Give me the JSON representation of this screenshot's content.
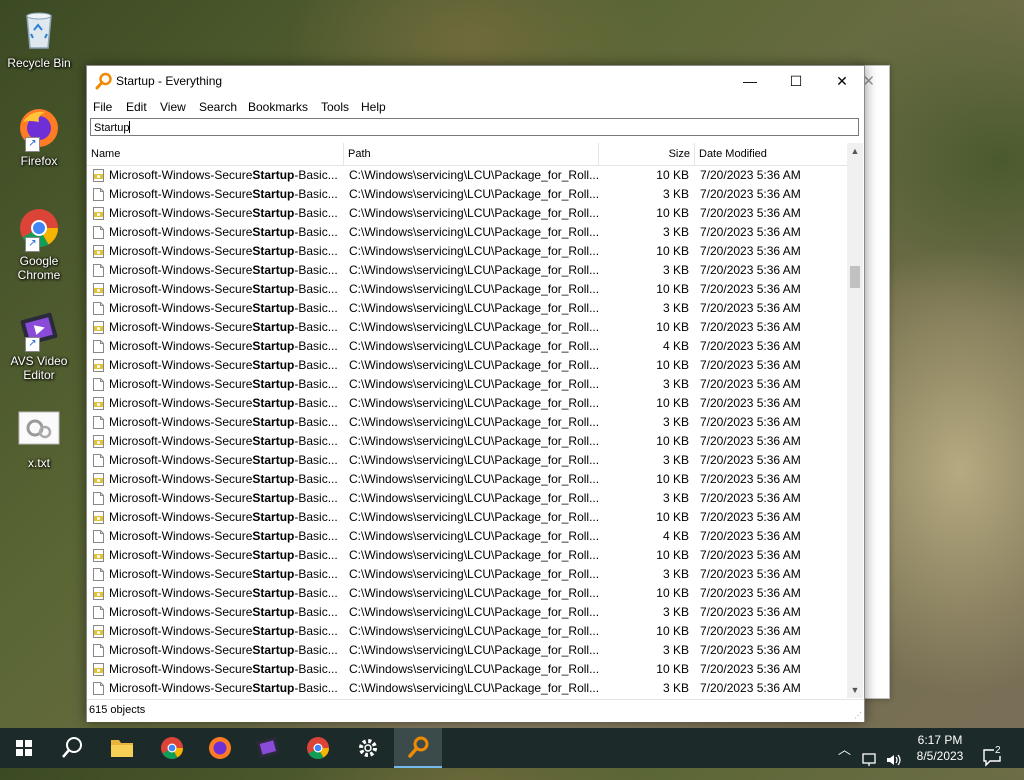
{
  "desktop": {
    "icons": [
      {
        "label": "Recycle Bin"
      },
      {
        "label": "Firefox"
      },
      {
        "label": "Google Chrome"
      },
      {
        "label": "AVS Video Editor"
      },
      {
        "label": "x.txt"
      }
    ]
  },
  "window": {
    "title": "Startup - Everything",
    "controls": {
      "minimize": "—",
      "maximize": "☐",
      "close": "✕"
    },
    "menu": [
      "File",
      "Edit",
      "View",
      "Search",
      "Bookmarks",
      "Tools",
      "Help"
    ],
    "search": {
      "value": "Startup"
    },
    "columns": {
      "name": "Name",
      "path": "Path",
      "size": "Size",
      "date": "Date Modified"
    },
    "rows": [
      {
        "name_prefix": "Microsoft-Windows-Secure",
        "name_match": "Startup",
        "name_suffix": "-Basic...",
        "path": "C:\\Windows\\servicing\\LCU\\Package_for_Roll...",
        "size": "10 KB",
        "date": "7/20/2023 5:36 AM",
        "type": "cat"
      },
      {
        "name_prefix": "Microsoft-Windows-Secure",
        "name_match": "Startup",
        "name_suffix": "-Basic...",
        "path": "C:\\Windows\\servicing\\LCU\\Package_for_Roll...",
        "size": "3 KB",
        "date": "7/20/2023 5:36 AM",
        "type": "doc"
      },
      {
        "name_prefix": "Microsoft-Windows-Secure",
        "name_match": "Startup",
        "name_suffix": "-Basic...",
        "path": "C:\\Windows\\servicing\\LCU\\Package_for_Roll...",
        "size": "10 KB",
        "date": "7/20/2023 5:36 AM",
        "type": "cat"
      },
      {
        "name_prefix": "Microsoft-Windows-Secure",
        "name_match": "Startup",
        "name_suffix": "-Basic...",
        "path": "C:\\Windows\\servicing\\LCU\\Package_for_Roll...",
        "size": "3 KB",
        "date": "7/20/2023 5:36 AM",
        "type": "doc"
      },
      {
        "name_prefix": "Microsoft-Windows-Secure",
        "name_match": "Startup",
        "name_suffix": "-Basic...",
        "path": "C:\\Windows\\servicing\\LCU\\Package_for_Roll...",
        "size": "10 KB",
        "date": "7/20/2023 5:36 AM",
        "type": "cat"
      },
      {
        "name_prefix": "Microsoft-Windows-Secure",
        "name_match": "Startup",
        "name_suffix": "-Basic...",
        "path": "C:\\Windows\\servicing\\LCU\\Package_for_Roll...",
        "size": "3 KB",
        "date": "7/20/2023 5:36 AM",
        "type": "doc"
      },
      {
        "name_prefix": "Microsoft-Windows-Secure",
        "name_match": "Startup",
        "name_suffix": "-Basic...",
        "path": "C:\\Windows\\servicing\\LCU\\Package_for_Roll...",
        "size": "10 KB",
        "date": "7/20/2023 5:36 AM",
        "type": "cat"
      },
      {
        "name_prefix": "Microsoft-Windows-Secure",
        "name_match": "Startup",
        "name_suffix": "-Basic...",
        "path": "C:\\Windows\\servicing\\LCU\\Package_for_Roll...",
        "size": "3 KB",
        "date": "7/20/2023 5:36 AM",
        "type": "doc"
      },
      {
        "name_prefix": "Microsoft-Windows-Secure",
        "name_match": "Startup",
        "name_suffix": "-Basic...",
        "path": "C:\\Windows\\servicing\\LCU\\Package_for_Roll...",
        "size": "10 KB",
        "date": "7/20/2023 5:36 AM",
        "type": "cat"
      },
      {
        "name_prefix": "Microsoft-Windows-Secure",
        "name_match": "Startup",
        "name_suffix": "-Basic...",
        "path": "C:\\Windows\\servicing\\LCU\\Package_for_Roll...",
        "size": "4 KB",
        "date": "7/20/2023 5:36 AM",
        "type": "doc"
      },
      {
        "name_prefix": "Microsoft-Windows-Secure",
        "name_match": "Startup",
        "name_suffix": "-Basic...",
        "path": "C:\\Windows\\servicing\\LCU\\Package_for_Roll...",
        "size": "10 KB",
        "date": "7/20/2023 5:36 AM",
        "type": "cat"
      },
      {
        "name_prefix": "Microsoft-Windows-Secure",
        "name_match": "Startup",
        "name_suffix": "-Basic...",
        "path": "C:\\Windows\\servicing\\LCU\\Package_for_Roll...",
        "size": "3 KB",
        "date": "7/20/2023 5:36 AM",
        "type": "doc"
      },
      {
        "name_prefix": "Microsoft-Windows-Secure",
        "name_match": "Startup",
        "name_suffix": "-Basic...",
        "path": "C:\\Windows\\servicing\\LCU\\Package_for_Roll...",
        "size": "10 KB",
        "date": "7/20/2023 5:36 AM",
        "type": "cat"
      },
      {
        "name_prefix": "Microsoft-Windows-Secure",
        "name_match": "Startup",
        "name_suffix": "-Basic...",
        "path": "C:\\Windows\\servicing\\LCU\\Package_for_Roll...",
        "size": "3 KB",
        "date": "7/20/2023 5:36 AM",
        "type": "doc"
      },
      {
        "name_prefix": "Microsoft-Windows-Secure",
        "name_match": "Startup",
        "name_suffix": "-Basic...",
        "path": "C:\\Windows\\servicing\\LCU\\Package_for_Roll...",
        "size": "10 KB",
        "date": "7/20/2023 5:36 AM",
        "type": "cat"
      },
      {
        "name_prefix": "Microsoft-Windows-Secure",
        "name_match": "Startup",
        "name_suffix": "-Basic...",
        "path": "C:\\Windows\\servicing\\LCU\\Package_for_Roll...",
        "size": "3 KB",
        "date": "7/20/2023 5:36 AM",
        "type": "doc"
      },
      {
        "name_prefix": "Microsoft-Windows-Secure",
        "name_match": "Startup",
        "name_suffix": "-Basic...",
        "path": "C:\\Windows\\servicing\\LCU\\Package_for_Roll...",
        "size": "10 KB",
        "date": "7/20/2023 5:36 AM",
        "type": "cat"
      },
      {
        "name_prefix": "Microsoft-Windows-Secure",
        "name_match": "Startup",
        "name_suffix": "-Basic...",
        "path": "C:\\Windows\\servicing\\LCU\\Package_for_Roll...",
        "size": "3 KB",
        "date": "7/20/2023 5:36 AM",
        "type": "doc"
      },
      {
        "name_prefix": "Microsoft-Windows-Secure",
        "name_match": "Startup",
        "name_suffix": "-Basic...",
        "path": "C:\\Windows\\servicing\\LCU\\Package_for_Roll...",
        "size": "10 KB",
        "date": "7/20/2023 5:36 AM",
        "type": "cat"
      },
      {
        "name_prefix": "Microsoft-Windows-Secure",
        "name_match": "Startup",
        "name_suffix": "-Basic...",
        "path": "C:\\Windows\\servicing\\LCU\\Package_for_Roll...",
        "size": "4 KB",
        "date": "7/20/2023 5:36 AM",
        "type": "doc"
      },
      {
        "name_prefix": "Microsoft-Windows-Secure",
        "name_match": "Startup",
        "name_suffix": "-Basic...",
        "path": "C:\\Windows\\servicing\\LCU\\Package_for_Roll...",
        "size": "10 KB",
        "date": "7/20/2023 5:36 AM",
        "type": "cat"
      },
      {
        "name_prefix": "Microsoft-Windows-Secure",
        "name_match": "Startup",
        "name_suffix": "-Basic...",
        "path": "C:\\Windows\\servicing\\LCU\\Package_for_Roll...",
        "size": "3 KB",
        "date": "7/20/2023 5:36 AM",
        "type": "doc"
      },
      {
        "name_prefix": "Microsoft-Windows-Secure",
        "name_match": "Startup",
        "name_suffix": "-Basic...",
        "path": "C:\\Windows\\servicing\\LCU\\Package_for_Roll...",
        "size": "10 KB",
        "date": "7/20/2023 5:36 AM",
        "type": "cat"
      },
      {
        "name_prefix": "Microsoft-Windows-Secure",
        "name_match": "Startup",
        "name_suffix": "-Basic...",
        "path": "C:\\Windows\\servicing\\LCU\\Package_for_Roll...",
        "size": "3 KB",
        "date": "7/20/2023 5:36 AM",
        "type": "doc"
      },
      {
        "name_prefix": "Microsoft-Windows-Secure",
        "name_match": "Startup",
        "name_suffix": "-Basic...",
        "path": "C:\\Windows\\servicing\\LCU\\Package_for_Roll...",
        "size": "10 KB",
        "date": "7/20/2023 5:36 AM",
        "type": "cat"
      },
      {
        "name_prefix": "Microsoft-Windows-Secure",
        "name_match": "Startup",
        "name_suffix": "-Basic...",
        "path": "C:\\Windows\\servicing\\LCU\\Package_for_Roll...",
        "size": "3 KB",
        "date": "7/20/2023 5:36 AM",
        "type": "doc"
      },
      {
        "name_prefix": "Microsoft-Windows-Secure",
        "name_match": "Startup",
        "name_suffix": "-Basic...",
        "path": "C:\\Windows\\servicing\\LCU\\Package_for_Roll...",
        "size": "10 KB",
        "date": "7/20/2023 5:36 AM",
        "type": "cat"
      },
      {
        "name_prefix": "Microsoft-Windows-Secure",
        "name_match": "Startup",
        "name_suffix": "-Basic...",
        "path": "C:\\Windows\\servicing\\LCU\\Package_for_Roll...",
        "size": "3 KB",
        "date": "7/20/2023 5:36 AM",
        "type": "doc"
      }
    ],
    "status": "615 objects"
  },
  "taskbar": {
    "items": [
      "start-icon",
      "search-icon",
      "file-explorer-icon",
      "chrome-icon",
      "firefox-icon",
      "avs-video-icon",
      "chrome-icon",
      "settings-icon",
      "everything-icon"
    ],
    "clock_time": "6:17 PM",
    "clock_date": "8/5/2023",
    "notification_count": "2"
  },
  "colors": {
    "accent": "#76b9ed",
    "taskbar": "#1c2a2a"
  }
}
